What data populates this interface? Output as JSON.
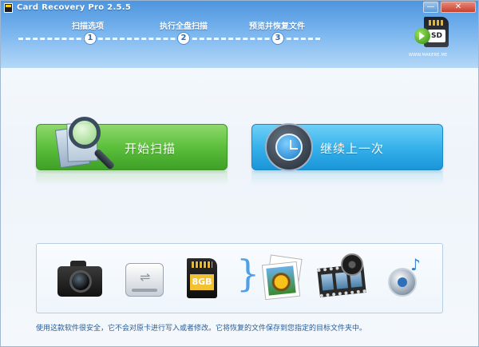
{
  "window": {
    "title": "Card Recovery Pro 2.5.5",
    "minimize_label": "—",
    "close_label": "✕"
  },
  "steps": [
    {
      "label": "扫描选项",
      "number": "1"
    },
    {
      "label": "执行全盘扫描",
      "number": "2"
    },
    {
      "label": "预览并恢复文件",
      "number": "3"
    }
  ],
  "logo": {
    "card_label": "SD",
    "site": "WWW.MAKERE.ME"
  },
  "actions": {
    "start_scan": "开始扫描",
    "continue_last": "继续上一次"
  },
  "media": {
    "card_capacity": "8GB",
    "brace": "}"
  },
  "footer": {
    "text": "使用这款软件很安全，它不会对原卡进行写入或者修改。它将恢复的文件保存到您指定的目标文件夹中。"
  },
  "colors": {
    "header": "#5b9fe3",
    "start_button": "#5cbf3c",
    "continue_button": "#37b2ec",
    "footer_text": "#2a5c95"
  }
}
